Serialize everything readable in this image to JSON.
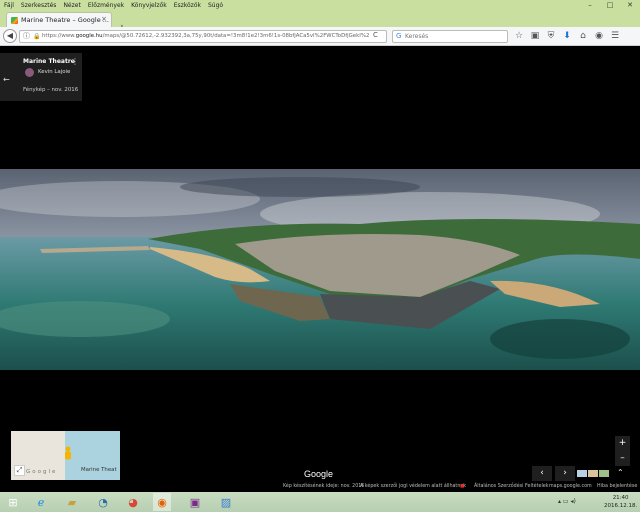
{
  "menu": [
    "Fájl",
    "Szerkesztés",
    "Nézet",
    "Előzmények",
    "Könyvjelzők",
    "Eszközök",
    "Súgó"
  ],
  "window_controls": {
    "minimize": "–",
    "maximize": "□",
    "close": "✕"
  },
  "tab": {
    "title": "Marine Theatre – Google ...",
    "close": "×",
    "new_tab": "+"
  },
  "address": {
    "prefix": "https://www.",
    "host": "google.hu",
    "rest": "/maps/@50.72612,-2.932392,3a,75y,90t/data=!3m8!1e2!3m6!1s-08bfjACa5vI%2FWCToDfjGekI%2",
    "reload": "C"
  },
  "search": {
    "placeholder": "Keresés"
  },
  "toolbar_icons": [
    "star-icon",
    "clipboard-icon",
    "shield-icon",
    "download-icon",
    "home-icon",
    "pocket-icon",
    "menu-icon"
  ],
  "card": {
    "title": "Marine Theatre",
    "author": "Kevin Lajoie",
    "date": "Fénykép – nov. 2016",
    "back": "←",
    "menu": "⋮"
  },
  "minimap": {
    "label": "Marine Theat",
    "google": "Google"
  },
  "google_logo": "Google",
  "controls": {
    "zoom_in": "+",
    "zoom_out": "–",
    "prev": "‹",
    "next": "›",
    "expand": "⌃"
  },
  "status": {
    "capture": "Kép készítésének ideje: nov. 2016",
    "copyright": "A képek szerzői jogi védelem alatt állhatnak",
    "terms": "Általános Szerződési Feltételek",
    "site": "maps.google.com",
    "report": "Hiba bejelentése"
  },
  "clock": {
    "time": "21:40",
    "date": "2016.12.18."
  },
  "colors": {
    "browser_chrome": "#c9dfa0",
    "card_bg": "#1f1f1f",
    "sea": "#3f8d8a"
  }
}
